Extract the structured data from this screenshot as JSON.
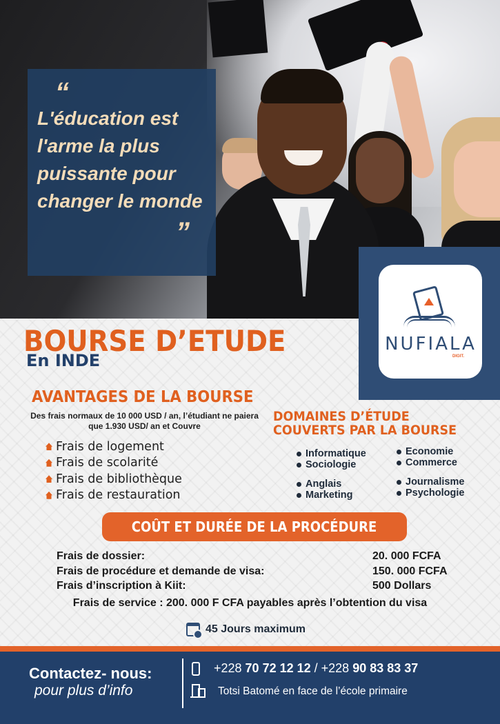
{
  "quote": {
    "open_mark": "“",
    "text": "L'éducation est l'arme la plus puissante pour changer le monde",
    "close_mark": "”"
  },
  "logo": {
    "name": "NUFIALA",
    "sub": "DIGIT."
  },
  "header": {
    "title": "BOURSE D’ETUDE",
    "subtitle": "En INDE"
  },
  "advantages": {
    "title": "AVANTAGES DE LA BOURSE",
    "description": "Des frais normaux de 10 000 USD / an, l’étudiant ne paiera que 1.930 USD/ an et Couvre",
    "items": [
      "Frais de logement",
      "Frais de scolarité",
      "Frais de bibliothèque",
      "Frais de restauration"
    ]
  },
  "domains": {
    "title_line1": "DOMAINES D’ÉTUDE",
    "title_line2": "COUVERTS PAR LA BOURSE",
    "col1_top": [
      "Informatique",
      "Sociologie"
    ],
    "col2_top": [
      "Economie",
      "Commerce"
    ],
    "col1_bottom": [
      "Anglais",
      "Marketing"
    ],
    "col2_bottom": [
      "Journalisme",
      "Psychologie"
    ]
  },
  "costs": {
    "banner": "COÛT ET DURÉE DE LA PROCÉDURE",
    "rows": [
      {
        "label": "Frais de dossier:",
        "value": "20. 000 FCFA"
      },
      {
        "label": "Frais de procédure et demande de visa:",
        "value": "150. 000 FCFA"
      },
      {
        "label": "Frais d’inscription à Kiit:",
        "value": "500 Dollars"
      }
    ],
    "service": "Frais de service : 200. 000 F CFA payables après l’obtention du visa",
    "duration": "45 Jours maximum"
  },
  "footer": {
    "contact_title": "Contactez- nous:",
    "contact_sub": "pour plus d’info",
    "phone_prefix1": "+228 ",
    "phone1": "70 72 12 12",
    "phone_sep": " / +228 ",
    "phone2": "90 83 83 37",
    "address": "Totsi Batomé en face  de l’école primaire"
  },
  "colors": {
    "orange": "#e3632a",
    "navy": "#22406a",
    "cream": "#f4dcb9"
  }
}
